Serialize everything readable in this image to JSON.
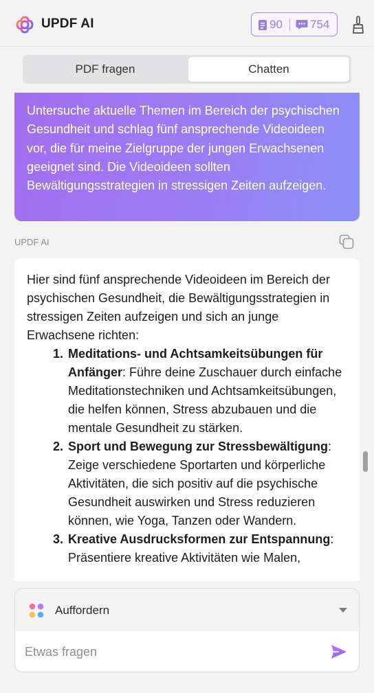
{
  "header": {
    "title": "UPDF AI",
    "credits_pages": "90",
    "credits_messages": "754",
    "logo_icon": "updf-logo-icon",
    "clean_icon": "broom-icon"
  },
  "tabs": [
    {
      "label": "PDF fragen",
      "active": false
    },
    {
      "label": "Chatten",
      "active": true
    }
  ],
  "chat": {
    "user_message": "Untersuche aktuelle Themen im Bereich der psychischen Gesundheit und schlag fünf ansprechende Videoideen vor, die für meine Zielgruppe der jungen Erwachsenen geeignet sind. Die Videoideen sollten Bewältigungsstrategien in stressigen Zeiten aufzeigen.",
    "ai_label": "UPDF AI",
    "ai_intro": "Hier sind fünf ansprechende Videoideen im Bereich der psychischen Gesundheit, die Bewältigungsstrategien in stressigen Zeiten aufzeigen und sich an junge Erwachsene richten:",
    "items": [
      {
        "num": "1.",
        "title": "Meditations- und Achtsamkeitsübungen für Anfänger",
        "text": ": Führe deine Zuschauer durch einfache Meditationstechniken und Achtsamkeitsübungen, die helfen können, Stress abzubauen und die mentale Gesundheit zu stärken."
      },
      {
        "num": "2.",
        "title": "Sport und Bewegung zur Stressbewältigung",
        "text": ": Zeige verschiedene Sportarten und körperliche Aktivitäten, die sich positiv auf die psychische Gesundheit auswirken und Stress reduzieren können, wie Yoga, Tanzen oder Wandern."
      },
      {
        "num": "3.",
        "title": "Kreative Ausdrucksformen zur Entspannung",
        "text": ": Präsentiere kreative Aktivitäten wie Malen,"
      }
    ]
  },
  "input": {
    "prompt_label": "Auffordern",
    "placeholder": "Etwas fragen",
    "send_icon": "send-icon"
  },
  "colors": {
    "accent": "#9b7ed9",
    "bubble_start": "#a26ef0",
    "bubble_end": "#8b8ff7"
  }
}
